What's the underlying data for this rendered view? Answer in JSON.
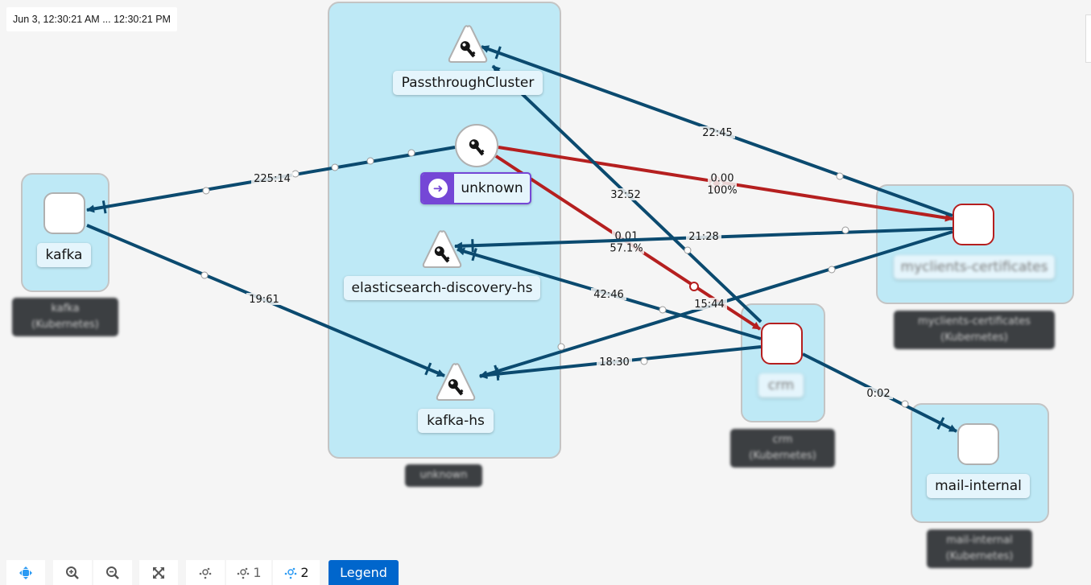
{
  "timestamp": "Jun 3, 12:30:21 AM ... 12:30:21 PM",
  "colors": {
    "edge_ok": "#0b4a6f",
    "edge_error": "#b51f1f",
    "namespace_fill": "#bee9f6",
    "accent": "#0066cc",
    "unknown_badge": "#7547d6"
  },
  "namespaces": [
    {
      "id": "kafka",
      "label": "kafka\n(Kubernetes)"
    },
    {
      "id": "unknown",
      "label": "unknown"
    },
    {
      "id": "crm",
      "label": "crm\n(Kubernetes)"
    },
    {
      "id": "myclients-certificates",
      "label": "myclients-certificates\n(Kubernetes)"
    },
    {
      "id": "mail-internal",
      "label": "mail-internal\n(Kubernetes)"
    }
  ],
  "nodes": {
    "kafka": {
      "label": "kafka",
      "type": "workload"
    },
    "passthrough": {
      "label": "PassthroughCluster",
      "type": "service"
    },
    "unknown": {
      "label": "unknown",
      "type": "unknown-source"
    },
    "elasticsearch": {
      "label": "elasticsearch-discovery-hs",
      "type": "service"
    },
    "kafka_hs": {
      "label": "kafka-hs",
      "type": "service"
    },
    "myclients": {
      "label": "myclients-certificates",
      "type": "workload",
      "status": "error"
    },
    "crm": {
      "label": "crm",
      "type": "workload",
      "status": "error"
    },
    "mail": {
      "label": "mail-internal",
      "type": "workload"
    }
  },
  "edges": [
    {
      "from": "unknown",
      "to": "kafka",
      "label": "225:14",
      "status": "ok"
    },
    {
      "from": "kafka",
      "to": "kafka_hs",
      "label": "19:61",
      "status": "ok"
    },
    {
      "from": "unknown",
      "to": "myclients",
      "label": "0.00\n100%",
      "status": "error"
    },
    {
      "from": "unknown",
      "to": "crm",
      "label": "0.01\n57.1%",
      "status": "error"
    },
    {
      "from": "myclients",
      "to": "passthrough",
      "label": "22:45",
      "status": "ok"
    },
    {
      "from": "crm",
      "to": "passthrough",
      "label": "32:52",
      "status": "ok"
    },
    {
      "from": "myclients",
      "to": "elasticsearch",
      "label": "21:28",
      "status": "ok"
    },
    {
      "from": "myclients",
      "to": "kafka_hs",
      "label": "15:44",
      "status": "ok"
    },
    {
      "from": "crm",
      "to": "elasticsearch",
      "label": "42:46",
      "status": "ok"
    },
    {
      "from": "crm",
      "to": "kafka_hs",
      "label": "18:30",
      "status": "ok"
    },
    {
      "from": "crm",
      "to": "mail",
      "label": "0:02",
      "status": "ok"
    }
  ],
  "toolbar": {
    "pan_icon": "move-icon",
    "zoom_in_icon": "zoom-in-icon",
    "zoom_out_icon": "zoom-out-icon",
    "fit_icon": "expand-icon",
    "layout_default_icon": "topology-icon",
    "layout_1_label": "1",
    "layout_2_label": "2",
    "legend_label": "Legend"
  }
}
